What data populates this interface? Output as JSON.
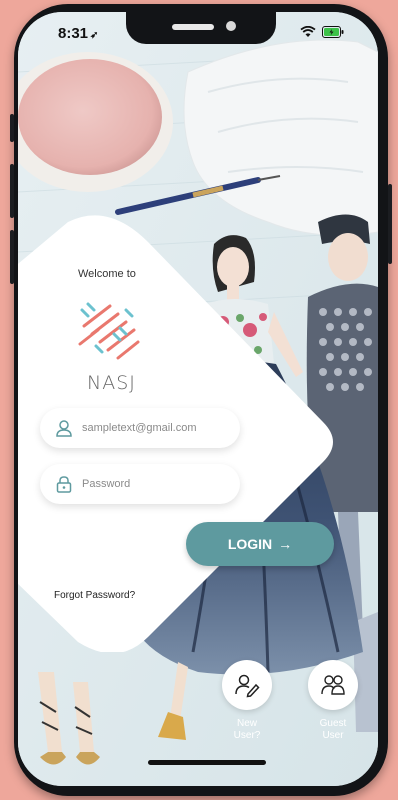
{
  "status_bar": {
    "time": "8:31",
    "location_glyph": "➶"
  },
  "welcome_text": "Welcome to",
  "brand": {
    "name": "NASJ",
    "logo_colors": [
      "#e9786e",
      "#6cc2cf"
    ]
  },
  "email_field": {
    "placeholder": "sampletext@gmail.com"
  },
  "password_field": {
    "placeholder": "Password"
  },
  "login_button": {
    "label": "LOGIN",
    "arrow": "→",
    "color": "#5e9a9f"
  },
  "forgot_password": "Forgot Password?",
  "new_user": {
    "line1": "New",
    "line2": "User?"
  },
  "guest_user": {
    "line1": "Guest",
    "line2": "User"
  }
}
